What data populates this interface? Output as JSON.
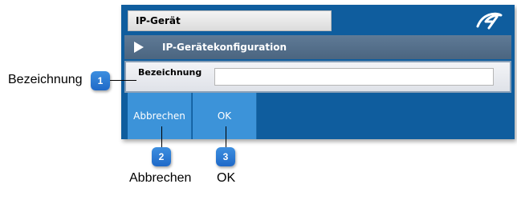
{
  "dialog": {
    "title": "IP-Gerät",
    "logo_icon": "brand-logo-icon",
    "section_icon": "play-icon",
    "section_title": "IP-Gerätekonfiguration",
    "field_label": "Bezeichnung",
    "field_value": "",
    "field_placeholder": "",
    "buttons": {
      "cancel": "Abbrechen",
      "ok": "OK"
    }
  },
  "callouts": [
    {
      "number": "1",
      "text": "Bezeichnung"
    },
    {
      "number": "2",
      "text": "Abbrechen"
    },
    {
      "number": "3",
      "text": "OK"
    }
  ],
  "colors": {
    "dialog_background": "#0f5d9e",
    "header_background": "#56708c",
    "button_background": "#3c93d9",
    "badge": "#2a7bd6"
  }
}
